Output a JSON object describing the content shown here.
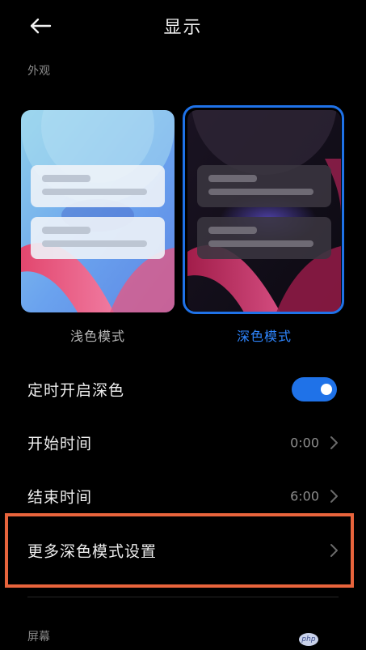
{
  "header": {
    "title": "显示",
    "back_icon": "arrow-left-icon"
  },
  "appearance": {
    "section_label": "外观",
    "modes": [
      {
        "label": "浅色模式",
        "selected": false
      },
      {
        "label": "深色模式",
        "selected": true
      }
    ]
  },
  "settings": {
    "scheduled_dark": {
      "label": "定时开启深色",
      "enabled": true
    },
    "start_time": {
      "label": "开始时间",
      "value": "0:00"
    },
    "end_time": {
      "label": "结束时间",
      "value": "6:00"
    },
    "more_dark_settings": {
      "label": "更多深色模式设置"
    }
  },
  "screen_section": {
    "label": "屏幕"
  },
  "watermark": {
    "text": "php"
  },
  "colors": {
    "accent": "#1f72e8",
    "highlight": "#e8643c",
    "background": "#000000"
  }
}
